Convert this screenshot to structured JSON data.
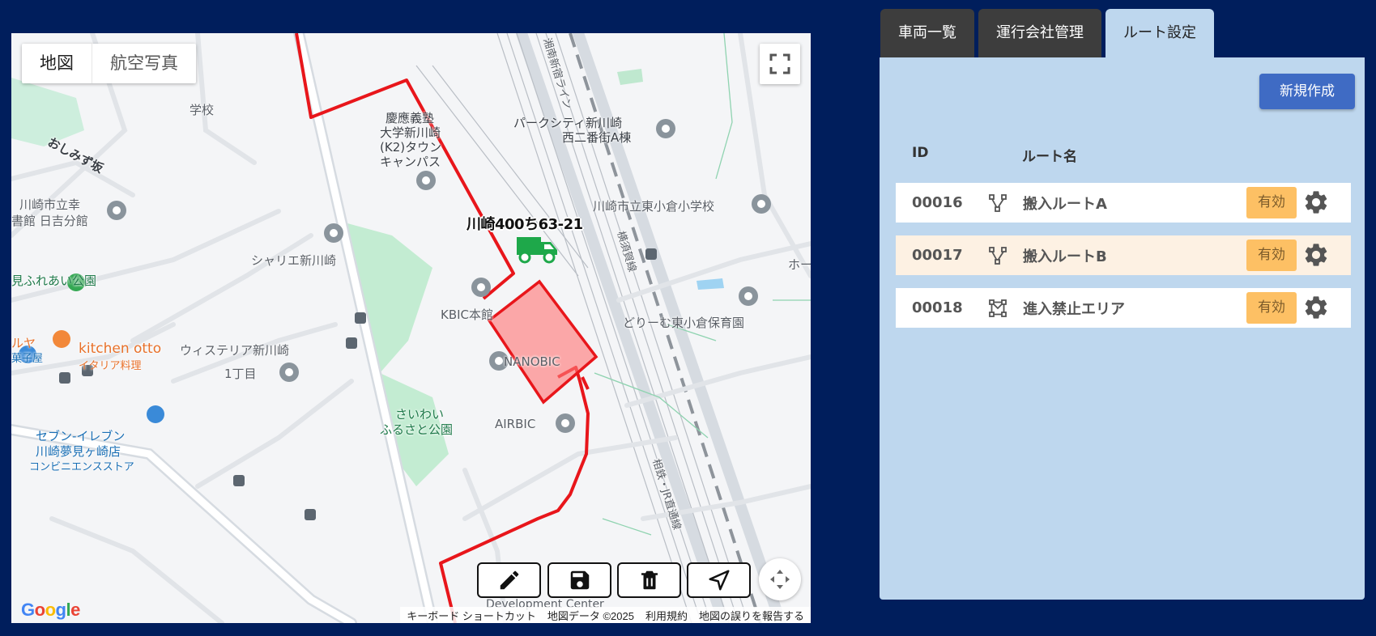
{
  "map": {
    "type_buttons": [
      "地図",
      "航空写真"
    ],
    "vehicle_label": "川崎400ち63-21",
    "labels": [
      {
        "text": "慶應義塾",
        "cls": "dark"
      },
      {
        "text": "大学新川崎",
        "cls": "dark"
      },
      {
        "text": "(K2)タウン",
        "cls": "dark"
      },
      {
        "text": "キャンパス",
        "cls": "dark"
      },
      {
        "text": "パークシティ新川崎",
        "cls": "dark"
      },
      {
        "text": "西二番街A棟",
        "cls": "dark"
      },
      {
        "text": "川崎市立東小倉小学校",
        "cls": ""
      },
      {
        "text": "おしみず坂",
        "cls": "dark"
      },
      {
        "text": "川崎市立幸",
        "cls": ""
      },
      {
        "text": "書館 日吉分館",
        "cls": ""
      },
      {
        "text": "シャリエ新川崎",
        "cls": ""
      },
      {
        "text": "見ふれあい公園",
        "cls": "green"
      },
      {
        "text": "KBIC本館",
        "cls": ""
      },
      {
        "text": "どりーむ東小倉保育園",
        "cls": ""
      },
      {
        "text": "kitchen otto",
        "cls": "orange"
      },
      {
        "text": "イタリア料理",
        "cls": "orange"
      },
      {
        "text": "ウィステリア新川崎",
        "cls": ""
      },
      {
        "text": "NANOBIC",
        "cls": ""
      },
      {
        "text": "1丁目",
        "cls": ""
      },
      {
        "text": "さいわい",
        "cls": "green"
      },
      {
        "text": "ふるさと公園",
        "cls": "green"
      },
      {
        "text": "AIRBIC",
        "cls": ""
      },
      {
        "text": "セブン-イレブン",
        "cls": "blue"
      },
      {
        "text": "川崎夢見ヶ崎店",
        "cls": "blue"
      },
      {
        "text": "コンビニエンスストア",
        "cls": "blue"
      },
      {
        "text": "湘南新宿ライン",
        "cls": ""
      },
      {
        "text": "横須賀線",
        "cls": ""
      },
      {
        "text": "相鉄・JR直通線",
        "cls": ""
      },
      {
        "text": "Development Center",
        "cls": ""
      },
      {
        "text": "ルヤ",
        "cls": "orange"
      },
      {
        "text": "菓子屋",
        "cls": "blue"
      },
      {
        "text": "学校",
        "cls": ""
      },
      {
        "text": "ホー",
        "cls": ""
      }
    ],
    "attribution": [
      "キーボード ショートカット",
      "地図データ ©2025",
      "利用規約",
      "地図の誤りを報告する"
    ],
    "google_logo": "Google"
  },
  "tabs": [
    "車両一覧",
    "運行会社管理",
    "ルート設定"
  ],
  "panel": {
    "new_button": "新規作成",
    "columns": {
      "id": "ID",
      "name": "ルート名"
    },
    "rows": [
      {
        "id": "00016",
        "name": "搬入ルートA",
        "status": "有効",
        "icon": "route-icon"
      },
      {
        "id": "00017",
        "name": "搬入ルートB",
        "status": "有効",
        "icon": "route-icon"
      },
      {
        "id": "00018",
        "name": "進入禁止エリア",
        "status": "有効",
        "icon": "polygon-area-icon"
      }
    ]
  },
  "colors": {
    "background": "#001e5c",
    "panel": "#bed7ee",
    "accent": "#3f6bc4",
    "badge": "#fdc064",
    "route": "#e8161b",
    "selected_row": "#fdf1e3"
  }
}
